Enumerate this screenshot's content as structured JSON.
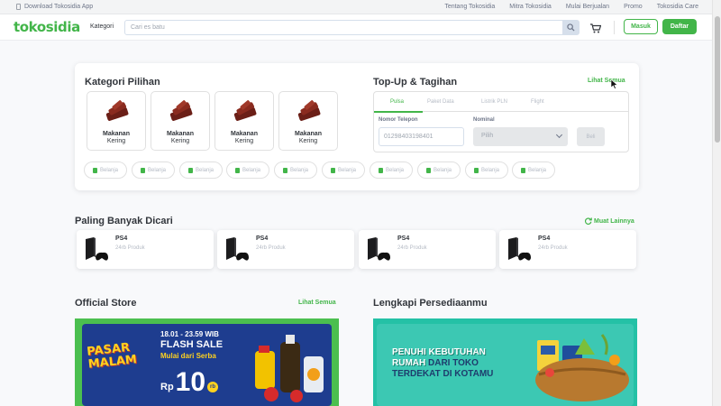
{
  "topbar": {
    "download": "Download Tokosidia App",
    "links": [
      "Tentang Tokosidia",
      "Mitra Tokosidia",
      "Mulai Berjualan",
      "Promo",
      "Tokosidia Care"
    ]
  },
  "header": {
    "logo": "tokosidia",
    "kategori": "Kategori",
    "search_placeholder": "Cari es batu",
    "masuk": "Masuk",
    "daftar": "Daftar"
  },
  "kategori_pilihan": {
    "title": "Kategori Pilihan",
    "items": [
      {
        "line1": "Makanan",
        "line2": "Kering"
      },
      {
        "line1": "Makanan",
        "line2": "Kering"
      },
      {
        "line1": "Makanan",
        "line2": "Kering"
      },
      {
        "line1": "Makanan",
        "line2": "Kering"
      }
    ],
    "chips": [
      "Belanja",
      "Belanja",
      "Belanja",
      "Belanja",
      "Belanja",
      "Belanja",
      "Belanja",
      "Belanja",
      "Belanja",
      "Belanja"
    ]
  },
  "topup": {
    "title": "Top-Up & Tagihan",
    "lihat_semua": "Lihat Semua",
    "tabs": [
      "Pulsa",
      "Paket Data",
      "Listrik PLN",
      "Flight"
    ],
    "active_tab": "Pulsa",
    "phone_label": "Nomor Telepon",
    "phone_value": "01298403198401",
    "nominal_label": "Nominal",
    "nominal_value": "Pilih",
    "buy_label": "Beli"
  },
  "paling_banyak": {
    "title": "Paling Banyak Dicari",
    "muat_lainnya": "Muat Lainnya",
    "items": [
      {
        "name": "PS4",
        "count": "24rb Produk"
      },
      {
        "name": "PS4",
        "count": "24rb Produk"
      },
      {
        "name": "PS4",
        "count": "24rb Produk"
      },
      {
        "name": "PS4",
        "count": "24rb Produk"
      }
    ]
  },
  "official_store": {
    "title": "Official Store",
    "lihat_semua": "Lihat Semua",
    "banner": {
      "brand_line1": "PASAR",
      "brand_line2": "MALAM",
      "time": "18.01 - 23.59 WIB",
      "headline": "FLASH SALE",
      "sub": "Mulai dari Serba",
      "currency": "Rp",
      "amount": "10",
      "suffix": "rb"
    }
  },
  "lengkapi": {
    "title": "Lengkapi Persediaanmu",
    "banner": {
      "line1": "PENUHI KEBUTUHAN",
      "line2a": "RUMAH",
      "line2b": " DARI TOKO",
      "line3": "TERDEKAT DI KOTAMU"
    }
  },
  "colors": {
    "brand": "#42b549",
    "text": "#31353b",
    "muted": "#b5bbc5"
  }
}
